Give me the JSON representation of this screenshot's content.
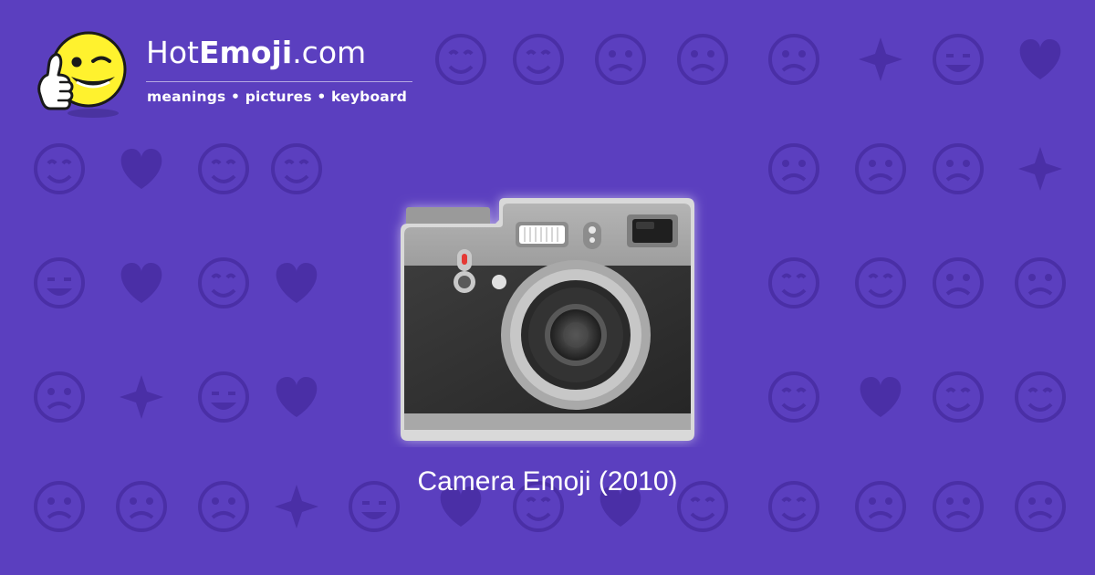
{
  "brand": {
    "name_prefix": "Hot",
    "name_bold": "Emoji",
    "name_suffix": ".com",
    "tagline": "meanings • pictures • keyboard",
    "mascot_icon": "thumbs-up-winking-face-icon"
  },
  "hero": {
    "emoji_icon": "camera-icon",
    "caption": "Camera Emoji (2010)"
  },
  "background": {
    "color": "#5b3fbf",
    "pattern_color": "#4a2fa6",
    "pattern_icons": [
      "relieved-face-icon",
      "kiss-face-icon",
      "hearts-icon",
      "smiling-face-icon",
      "weary-face-icon",
      "ok-hand-icon",
      "expressionless-face-icon",
      "eyes-icon",
      "smirking-face-icon",
      "recycle-icon",
      "raising-hands-icon",
      "music-notes-icon",
      "see-no-evil-monkey-icon",
      "victory-hand-icon",
      "sleeping-face-icon",
      "grinning-face-icon",
      "sparkles-icon",
      "striped-heart-icon",
      "broken-heart-icon",
      "confused-face-icon",
      "tongue-out-face-icon",
      "frowning-face-icon",
      "heart-with-arrow-icon",
      "revolving-hearts-icon",
      "heart-icon",
      "fearful-face-icon",
      "smiling-imp-icon",
      "angry-face-icon",
      "left-arrow-icon",
      "fire-icon",
      "party-popper-icon",
      "rose-icon",
      "sun-icon",
      "flexed-biceps-icon",
      "check-mark-icon",
      "squinting-face-icon",
      "heart-eyes-cat-icon",
      "waving-hand-icon",
      "mask-face-icon",
      "camera-icon",
      "crying-face-icon",
      "beaming-face-icon"
    ]
  }
}
